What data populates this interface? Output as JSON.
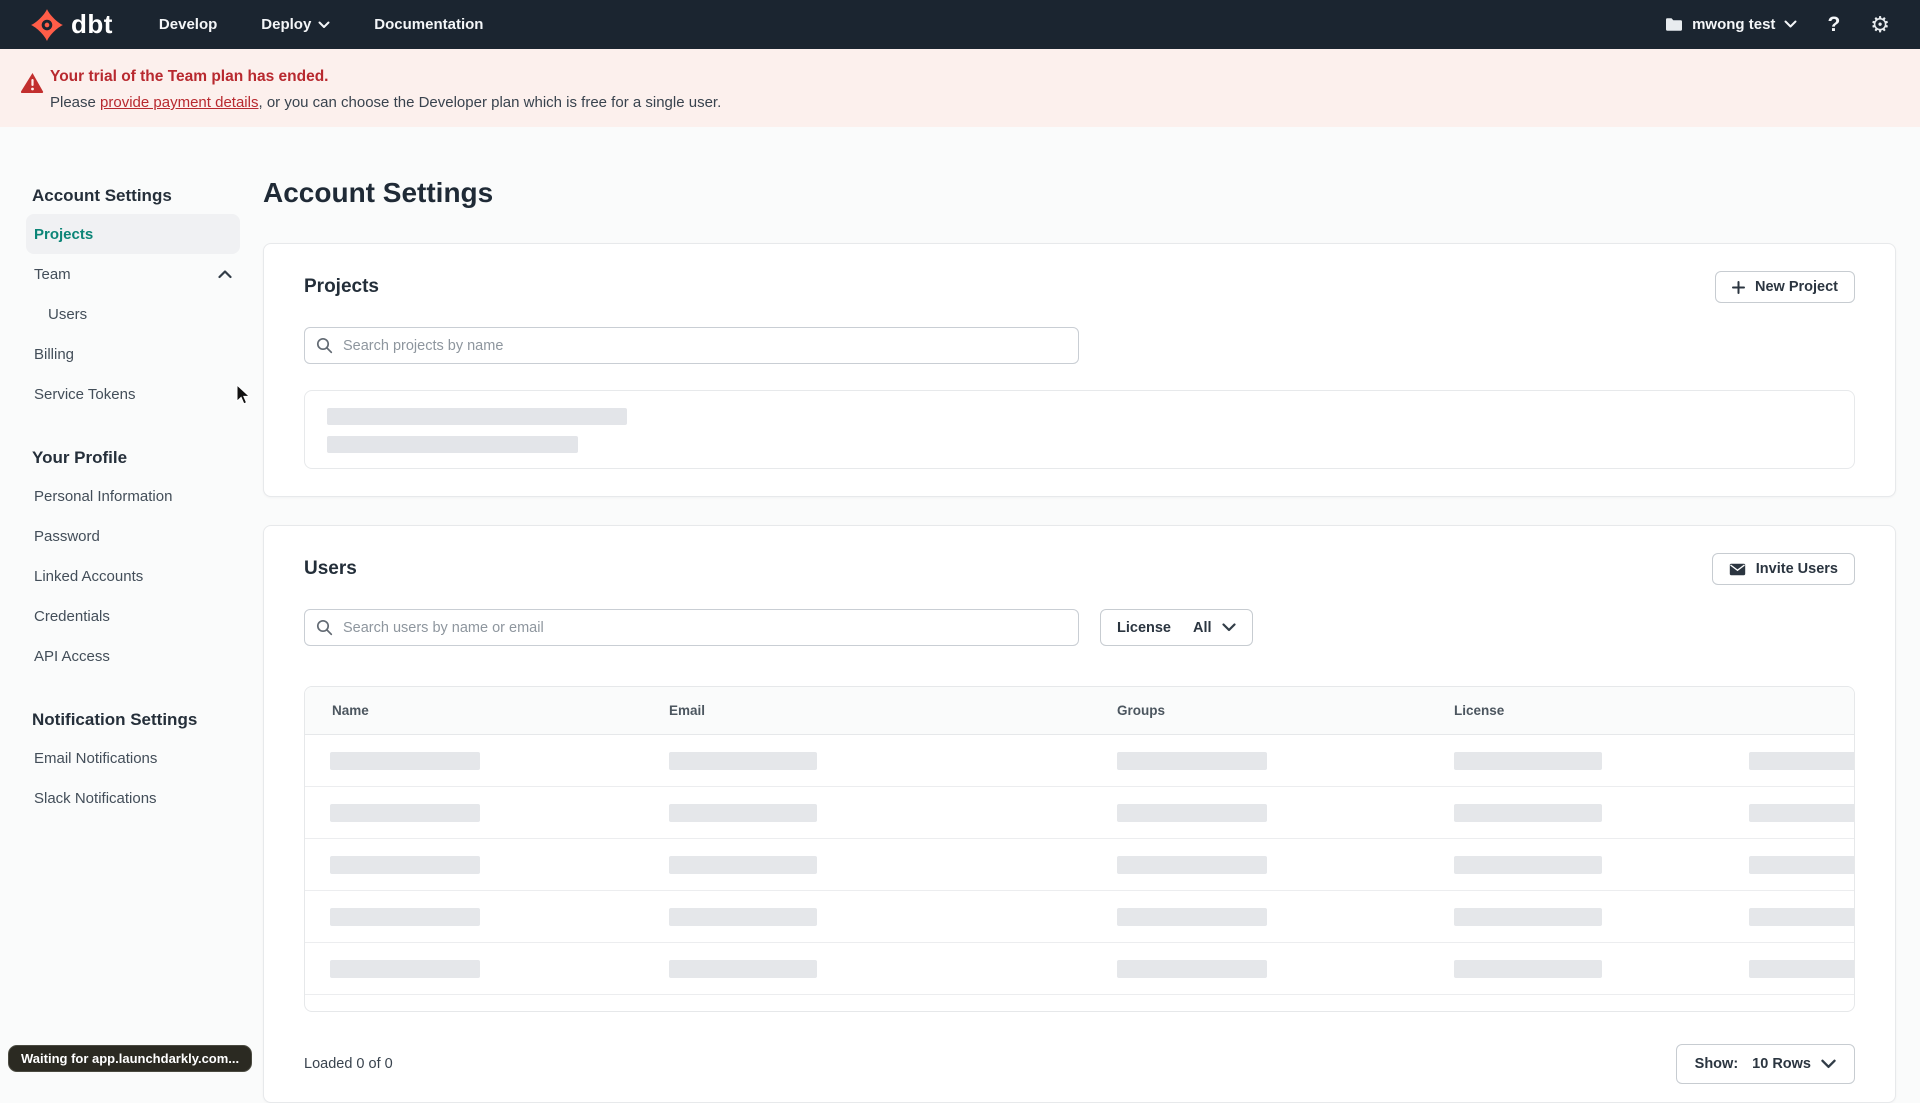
{
  "colors": {
    "brand_orange": "#FF5D48",
    "navbar_bg": "#1B2530",
    "accent_teal": "#0C8577",
    "alert_red": "#B8292F",
    "alert_bg": "#FCF0ED",
    "skeleton_gray": "#E5E7EA"
  },
  "navbar": {
    "logo_text": "dbt",
    "links": [
      {
        "label": "Develop"
      },
      {
        "label": "Deploy"
      },
      {
        "label": "Documentation"
      }
    ],
    "account_label": "mwong test",
    "icons": {
      "account": "folder-icon",
      "account_caret": "chevron-down-icon",
      "deploy_caret": "chevron-down-icon",
      "help": "question-mark-icon",
      "settings": "gear-icon"
    }
  },
  "trial_banner": {
    "title": "Your trial of the Team plan has ended.",
    "body_prefix": "Please ",
    "link_text": "provide payment details",
    "body_suffix": ", or you can choose the Developer plan which is free for a single user.",
    "icon": "warning-triangle-icon"
  },
  "sidebar": {
    "sections": [
      {
        "heading": "Account Settings",
        "items": [
          {
            "label": "Projects",
            "selected": true
          },
          {
            "label": "Team",
            "expanded": true
          },
          {
            "label": "Users",
            "indented": true
          },
          {
            "label": "Billing"
          },
          {
            "label": "Service Tokens"
          }
        ]
      },
      {
        "heading": "Your Profile",
        "items": [
          {
            "label": "Personal Information"
          },
          {
            "label": "Password"
          },
          {
            "label": "Linked Accounts"
          },
          {
            "label": "Credentials"
          },
          {
            "label": "API Access"
          }
        ]
      },
      {
        "heading": "Notification Settings",
        "items": [
          {
            "label": "Email Notifications"
          },
          {
            "label": "Slack Notifications"
          }
        ]
      }
    ]
  },
  "page": {
    "title": "Account Settings"
  },
  "projects_section": {
    "heading": "Projects",
    "new_project_button": "New Project",
    "search_placeholder": "Search projects by name"
  },
  "users_section": {
    "heading": "Users",
    "invite_users_button": "Invite Users",
    "search_placeholder": "Search users by name or email",
    "license_filter_label": "License",
    "license_filter_value": "All",
    "table_columns": [
      "Name",
      "Email",
      "Groups",
      "License"
    ],
    "skeleton_row_count": 5,
    "loaded_text": "Loaded 0 of 0",
    "show_label": "Show:",
    "show_value": "10 Rows"
  },
  "status_bubble": "Waiting for app.launchdarkly.com..."
}
